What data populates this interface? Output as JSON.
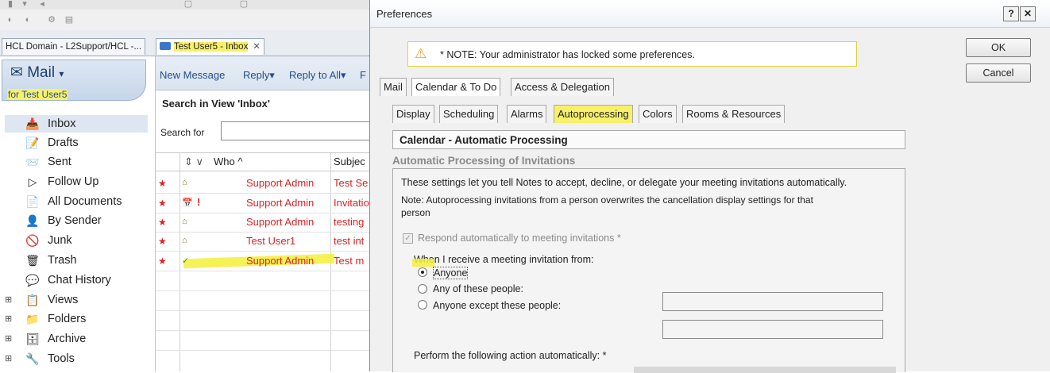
{
  "tabs": [
    {
      "label": "HCL Domain - L2Support/HCL -..."
    },
    {
      "label": "Test User5 - Inbox"
    }
  ],
  "sidebar": {
    "title": "Mail",
    "user": "for Test User5",
    "items": [
      {
        "label": "Inbox",
        "icon": "inbox-icon",
        "glyph": "📥"
      },
      {
        "label": "Drafts",
        "icon": "drafts-icon",
        "glyph": "📝"
      },
      {
        "label": "Sent",
        "icon": "sent-icon",
        "glyph": "📨"
      },
      {
        "label": "Follow Up",
        "icon": "follow-up-icon",
        "glyph": "▷"
      },
      {
        "label": "All Documents",
        "icon": "all-documents-icon",
        "glyph": "📄"
      },
      {
        "label": "By Sender",
        "icon": "by-sender-icon",
        "glyph": "👤"
      },
      {
        "label": "Junk",
        "icon": "junk-icon",
        "glyph": "🚫"
      },
      {
        "label": "Trash",
        "icon": "trash-icon",
        "glyph": "🗑"
      },
      {
        "label": "Chat History",
        "icon": "chat-history-icon",
        "glyph": "💬"
      },
      {
        "label": "Views",
        "icon": "views-icon",
        "glyph": "📋"
      },
      {
        "label": "Folders",
        "icon": "folders-icon",
        "glyph": "📁"
      },
      {
        "label": "Archive",
        "icon": "archive-icon",
        "glyph": "🗄"
      },
      {
        "label": "Tools",
        "icon": "tools-icon",
        "glyph": "🔧"
      }
    ]
  },
  "center": {
    "actions": [
      "New Message",
      "Reply▾",
      "Reply to All▾",
      "F"
    ],
    "search_title": "Search in View 'Inbox'",
    "search_label": "Search for",
    "columns": {
      "sort": "⇕ ∨",
      "who": "Who ^",
      "subject": "Subjec"
    },
    "rows": [
      {
        "who": "Support Admin",
        "subject": "Test Se"
      },
      {
        "who": "Support Admin",
        "subject": "Invitatio",
        "flag": "!"
      },
      {
        "who": "Support Admin",
        "subject": "testing"
      },
      {
        "who": "Test User1",
        "subject": "test int"
      },
      {
        "who": "Support Admin",
        "subject": "Test m"
      }
    ]
  },
  "dialog": {
    "title": "Preferences",
    "help_btn": "?",
    "close_btn": "✕",
    "note": "* NOTE: Your administrator has locked some preferences.",
    "ok": "OK",
    "cancel": "Cancel",
    "tabs": [
      "Mail",
      "Calendar & To Do",
      "Access & Delegation"
    ],
    "subtabs": [
      "Display",
      "Scheduling",
      "Alarms",
      "Autoprocessing",
      "Colors",
      "Rooms & Resources"
    ],
    "section_title": "Calendar - Automatic Processing",
    "sub_caption": "Automatic Processing of Invitations",
    "desc1": "These settings let you tell Notes to accept, decline, or delegate your meeting invitations automatically.",
    "desc2a": "Note: Autoprocessing invitations from a person overwrites the cancellation display settings for that",
    "desc2b": "person",
    "respond_label": "Respond automatically to meeting invitations *",
    "when_label": "When I receive a meeting invitation from:",
    "radio_options": [
      "Anyone",
      "Any of these people:",
      "Anyone except these people:"
    ],
    "perform_label": "Perform the following action automatically: *",
    "colors": {
      "accent": "#1f4f8f",
      "unread": "#e02020",
      "highlight": "#f7f06a"
    }
  }
}
